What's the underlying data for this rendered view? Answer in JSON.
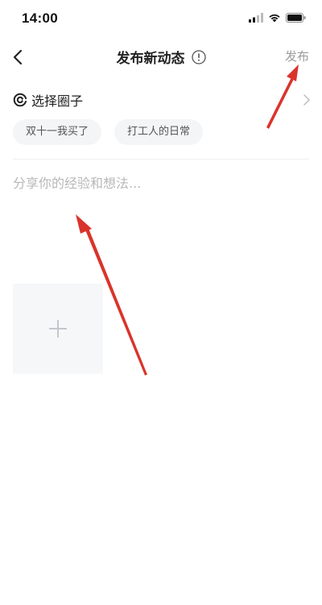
{
  "status_bar": {
    "time": "14:00"
  },
  "header": {
    "title": "发布新动态",
    "publish_label": "发布",
    "back_icon": "chevron-left-icon",
    "info_icon": "info-icon"
  },
  "circle_selector": {
    "label": "选择圈子",
    "icon": "circle-target-icon",
    "arrow_icon": "chevron-right-icon"
  },
  "tags": [
    {
      "label": "双十一我买了"
    },
    {
      "label": "打工人的日常"
    }
  ],
  "composer": {
    "placeholder": "分享你的经验和想法...",
    "value": ""
  },
  "media": {
    "add_icon": "plus-icon"
  },
  "colors": {
    "annotation_arrow": "#d9342b",
    "muted_text": "#9b9b9b",
    "chip_bg": "#f4f5f7"
  }
}
